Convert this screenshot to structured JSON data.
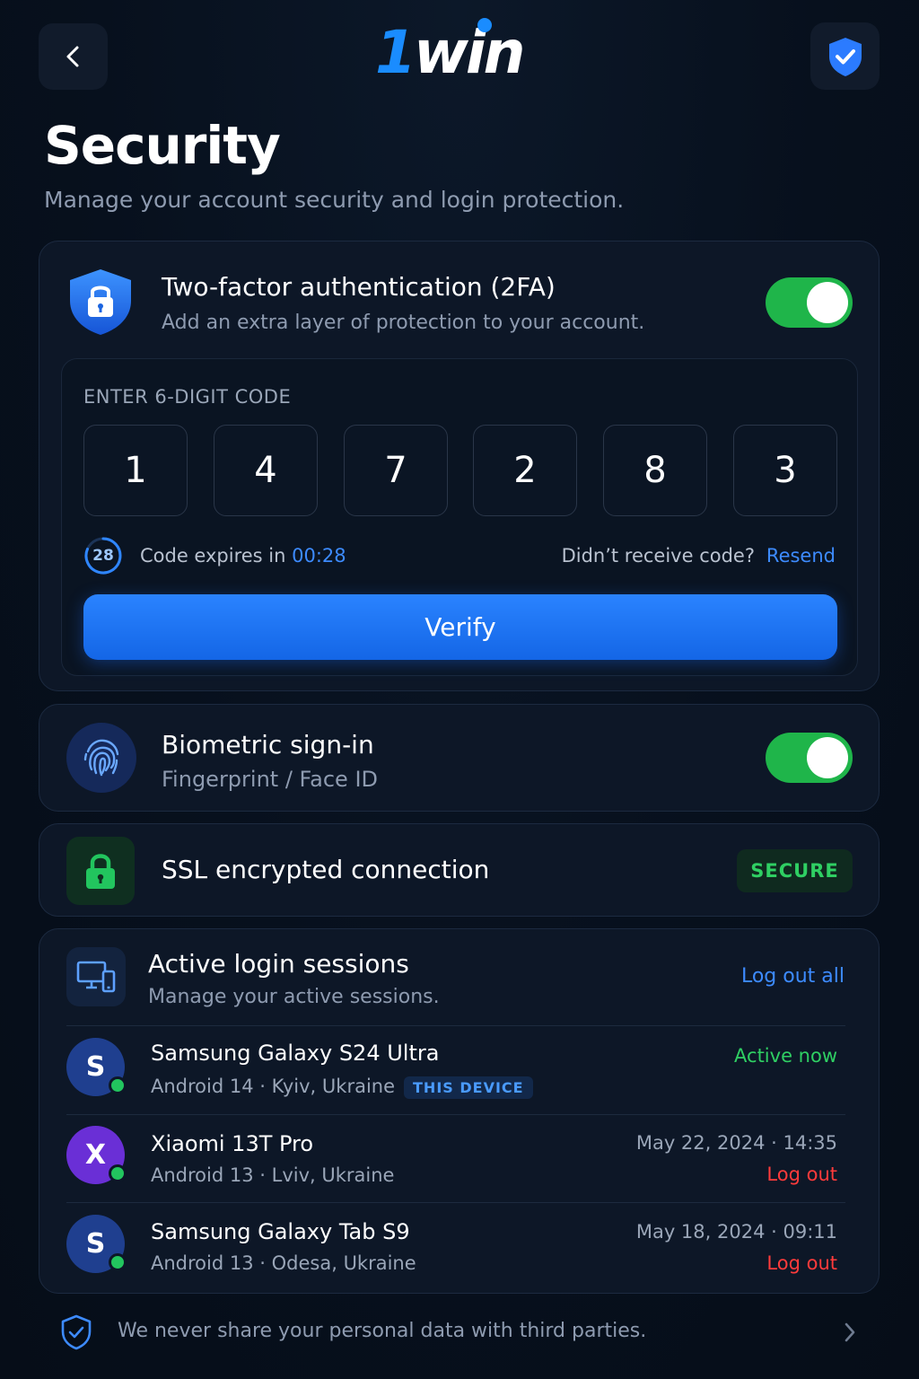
{
  "app": {
    "logo_one": "1",
    "logo_win": "win"
  },
  "header": {
    "title": "Security",
    "subtitle": "Manage your account security and login protection."
  },
  "two_factor": {
    "title": "Two-factor authentication (2FA)",
    "subtitle": "Add an extra layer of protection to your account.",
    "enabled": true,
    "code_label": "ENTER 6-DIGIT CODE",
    "digits": [
      "1",
      "4",
      "7",
      "2",
      "8",
      "3"
    ],
    "timer_seconds": "28",
    "expires_prefix": "Code expires in ",
    "expires_time": "00:28",
    "didnt_receive": "Didn’t receive code?",
    "resend_label": "Resend",
    "verify_label": "Verify"
  },
  "biometric": {
    "title": "Biometric sign-in",
    "subtitle": "Fingerprint / Face ID",
    "enabled": true
  },
  "ssl": {
    "title": "SSL encrypted connection",
    "badge": "SECURE"
  },
  "sessions": {
    "title": "Active login sessions",
    "subtitle": "Manage your active sessions.",
    "logout_all_label": "Log out all",
    "items": [
      {
        "initial": "S",
        "name": "Samsung Galaxy S24 Ultra",
        "os": "Android 14",
        "location": "Kyiv, Ukraine",
        "tag": "THIS DEVICE",
        "status": "Active now",
        "avatar_color": "#1f3f8f"
      },
      {
        "initial": "X",
        "name": "Xiaomi 13T Pro",
        "os": "Android 13",
        "location": "Lviv, Ukraine",
        "date": "May 22, 2024",
        "time": "14:35",
        "action": "Log out",
        "avatar_color": "#6a2fd6"
      },
      {
        "initial": "S",
        "name": "Samsung Galaxy Tab S9",
        "os": "Android 13",
        "location": "Odesa, Ukraine",
        "date": "May 18, 2024",
        "time": "09:11",
        "action": "Log out",
        "avatar_color": "#1f3f8f"
      }
    ]
  },
  "footer": {
    "text": "We never share your personal data with third parties."
  },
  "colors": {
    "accent": "#3d8bff",
    "toggle_on": "#1fb54a",
    "danger": "#ff3b3b",
    "success": "#2fcf63"
  },
  "icons": [
    "chevron-left-icon",
    "shield-check-icon",
    "lock-icon",
    "fingerprint-icon",
    "padlock-icon",
    "devices-icon",
    "chevron-right-icon"
  ]
}
